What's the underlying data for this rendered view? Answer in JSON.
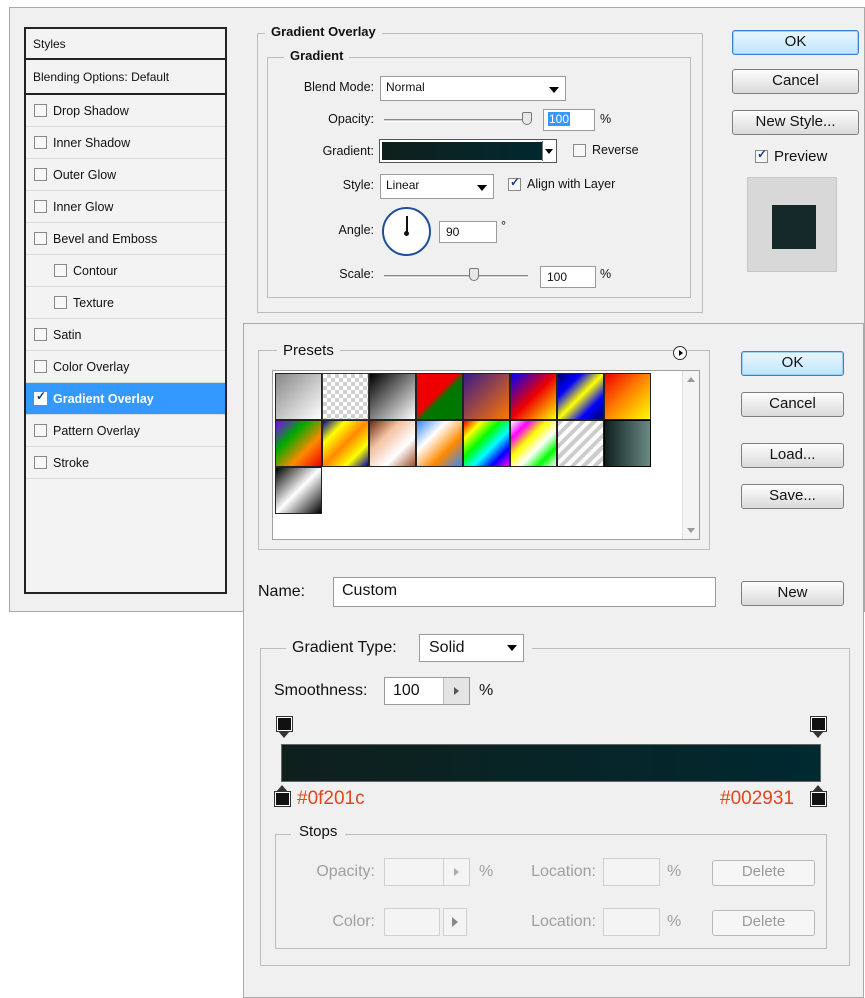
{
  "layer_style": {
    "styles_header": "Styles",
    "blending_options": "Blending Options: Default",
    "items": [
      {
        "label": "Drop Shadow",
        "checked": false
      },
      {
        "label": "Inner Shadow",
        "checked": false
      },
      {
        "label": "Outer Glow",
        "checked": false
      },
      {
        "label": "Inner Glow",
        "checked": false
      },
      {
        "label": "Bevel and Emboss",
        "checked": false
      },
      {
        "label": "Contour",
        "checked": false
      },
      {
        "label": "Texture",
        "checked": false
      },
      {
        "label": "Satin",
        "checked": false
      },
      {
        "label": "Color Overlay",
        "checked": false
      },
      {
        "label": "Gradient Overlay",
        "checked": true
      },
      {
        "label": "Pattern Overlay",
        "checked": false
      },
      {
        "label": "Stroke",
        "checked": false
      }
    ],
    "section_title": "Gradient Overlay",
    "group_title": "Gradient",
    "blend_mode_label": "Blend Mode:",
    "blend_mode_value": "Normal",
    "opacity_label": "Opacity:",
    "opacity_value": "100",
    "opacity_unit": "%",
    "gradient_label": "Gradient:",
    "reverse_label": "Reverse",
    "style_label": "Style:",
    "style_value": "Linear",
    "align_label": "Align with Layer",
    "angle_label": "Angle:",
    "angle_value": "90",
    "angle_unit": "°",
    "scale_label": "Scale:",
    "scale_value": "100",
    "scale_unit": "%",
    "ok_label": "OK",
    "cancel_label": "Cancel",
    "new_style_label": "New Style...",
    "preview_label": "Preview"
  },
  "gradient_editor": {
    "presets_title": "Presets",
    "ok_label": "OK",
    "cancel_label": "Cancel",
    "load_label": "Load...",
    "save_label": "Save...",
    "name_label": "Name:",
    "name_value": "Custom",
    "new_label": "New",
    "gradient_type_label": "Gradient Type:",
    "gradient_type_value": "Solid",
    "smoothness_label": "Smoothness:",
    "smoothness_value": "100",
    "smoothness_unit": "%",
    "stop_left_color": "#0f201c",
    "stop_right_color": "#002931",
    "stops_title": "Stops",
    "opacity_label": "Opacity:",
    "color_label": "Color:",
    "location_label": "Location:",
    "percent": "%",
    "delete_label": "Delete"
  },
  "colors": {
    "selection": "#3399ff",
    "hex_text": "#e0461c",
    "gradient_start": "#0f201c",
    "gradient_end": "#002931"
  }
}
